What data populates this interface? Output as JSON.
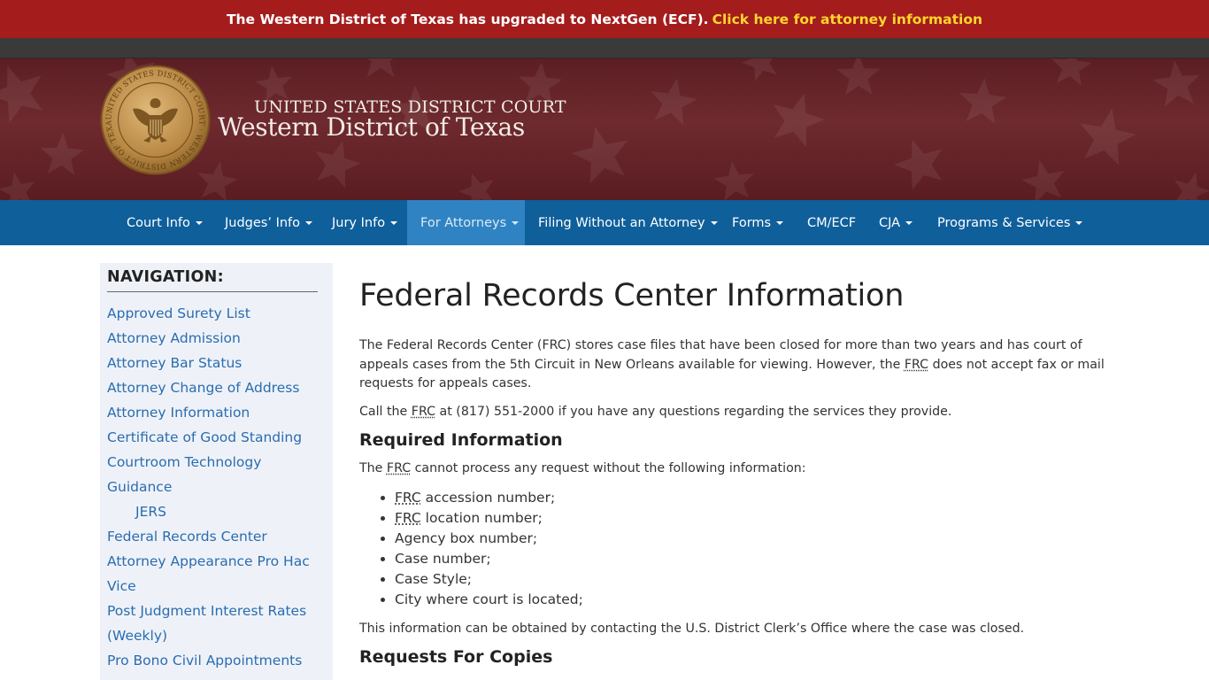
{
  "alert": {
    "text": "The Western District of Texas has upgraded to NextGen (ECF).",
    "link": "Click here for attorney information"
  },
  "header": {
    "court_line1": "UNITED STATES DISTRICT COURT",
    "court_line2": "Western District of Texas",
    "seal_ring_text": "UNITED STATES DISTRICT COURT · WESTERN DISTRICT OF TEXAS"
  },
  "nav": {
    "items": [
      {
        "label": "Court Info",
        "dropdown": true
      },
      {
        "label": "Judges’ Info",
        "dropdown": true
      },
      {
        "label": "Jury Info",
        "dropdown": true
      },
      {
        "label": "For Attorneys",
        "dropdown": true,
        "active": true
      },
      {
        "label": "Filing Without an Attorney",
        "dropdown": true
      },
      {
        "label": "Forms",
        "dropdown": true
      },
      {
        "label": "CM/ECF",
        "dropdown": false
      },
      {
        "label": "CJA",
        "dropdown": true
      },
      {
        "label": "Programs & Services",
        "dropdown": true
      }
    ]
  },
  "sidebar": {
    "heading": "NAVIGATION:",
    "items": [
      "Approved Surety List",
      "Attorney Admission",
      "Attorney Bar Status",
      "Attorney Change of Address",
      "Attorney Information",
      "Certificate of Good Standing",
      "Courtroom Technology",
      "Guidance",
      "JERS",
      "Federal Records Center",
      "Attorney Appearance Pro Hac",
      "Vice",
      "Post Judgment Interest Rates",
      "(Weekly)",
      "Pro Bono Civil Appointments"
    ]
  },
  "main": {
    "title": "Federal Records Center Information",
    "para1_a": "The Federal Records Center (FRC) stores case files that have been closed for more than two years and has court of appeals cases from the 5th Circuit in New Orleans available for viewing. However, the ",
    "frc": "FRC",
    "para1_b": " does not accept fax or mail requests for appeals cases.",
    "para2_a": "Call the ",
    "para2_b": " at (817) 551-2000 if you have any questions regarding the services they provide.",
    "heading1": "Required Information",
    "para3_a": "The ",
    "para3_b": " cannot process any request without the following information:",
    "list": [
      {
        "frc_prefix": true,
        "text": " accession number;"
      },
      {
        "frc_prefix": true,
        "text": " location number;"
      },
      {
        "frc_prefix": false,
        "text": "Agency box number;"
      },
      {
        "frc_prefix": false,
        "text": "Case number;"
      },
      {
        "frc_prefix": false,
        "text": "Case Style;"
      },
      {
        "frc_prefix": false,
        "text": "City where court is located;"
      }
    ],
    "para4": "This information can be obtained by contacting the U.S. District Clerk’s Office where the case was closed.",
    "heading2": "Requests For Copies"
  },
  "colors": {
    "alert_bg": "#a41c1c",
    "alert_link": "#ffd62e",
    "banner_bg": "#6e2a2e",
    "nav_bg": "#0f5f9b",
    "nav_active_bg": "#2f83c2",
    "link": "#2b6cb0",
    "sidebar_bg": "#eef2f8"
  }
}
